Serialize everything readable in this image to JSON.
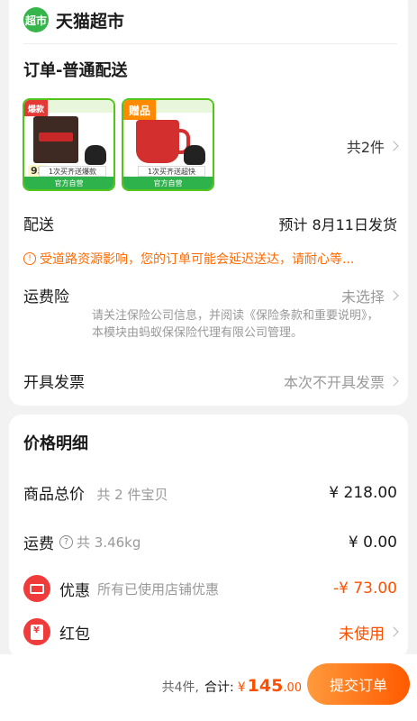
{
  "store": {
    "logo_text": "超市",
    "name": "天猫超市"
  },
  "order": {
    "title": "订单-普通配送",
    "products": [
      {
        "tag": "爆款",
        "price_badge": "95",
        "promo_band": "1次买齐送爆款",
        "footer": "官方自营"
      },
      {
        "tag": "赠品",
        "promo_band": "1次买齐送超快",
        "footer": "官方自营"
      }
    ],
    "count_text": "共2件"
  },
  "delivery": {
    "label": "配送",
    "value": "预计 8月11日发货",
    "notice": "受道路资源影响，您的订单可能会延迟送达，请耐心等..."
  },
  "insurance": {
    "label": "运费险",
    "value": "未选择",
    "desc": "请关注保险公司信息，并阅读《保险条款和重要说明》，本模块由蚂蚁保保险代理有限公司管理。"
  },
  "invoice": {
    "label": "开具发票",
    "value": "本次不开具发票"
  },
  "price_detail": {
    "title": "价格明细",
    "goods_total": {
      "label": "商品总价",
      "sub": "共 2 件宝贝",
      "value": "¥ 218.00"
    },
    "shipping": {
      "label": "运费",
      "sub": "共 3.46kg",
      "value": "¥ 0.00"
    },
    "discount": {
      "label": "优惠",
      "sub": "所有已使用店铺优惠",
      "value": "-¥ 73.00"
    },
    "red_packet": {
      "label": "红包",
      "value": "未使用"
    }
  },
  "footer": {
    "items_text": "共4件,",
    "total_label": "合计:",
    "currency": "¥",
    "amount_int": "145",
    "amount_dec": ".00",
    "submit_label": "提交订单"
  },
  "colors": {
    "accent": "#ff5000",
    "brand_green": "#35b54a",
    "notice": "#ff6a00"
  }
}
